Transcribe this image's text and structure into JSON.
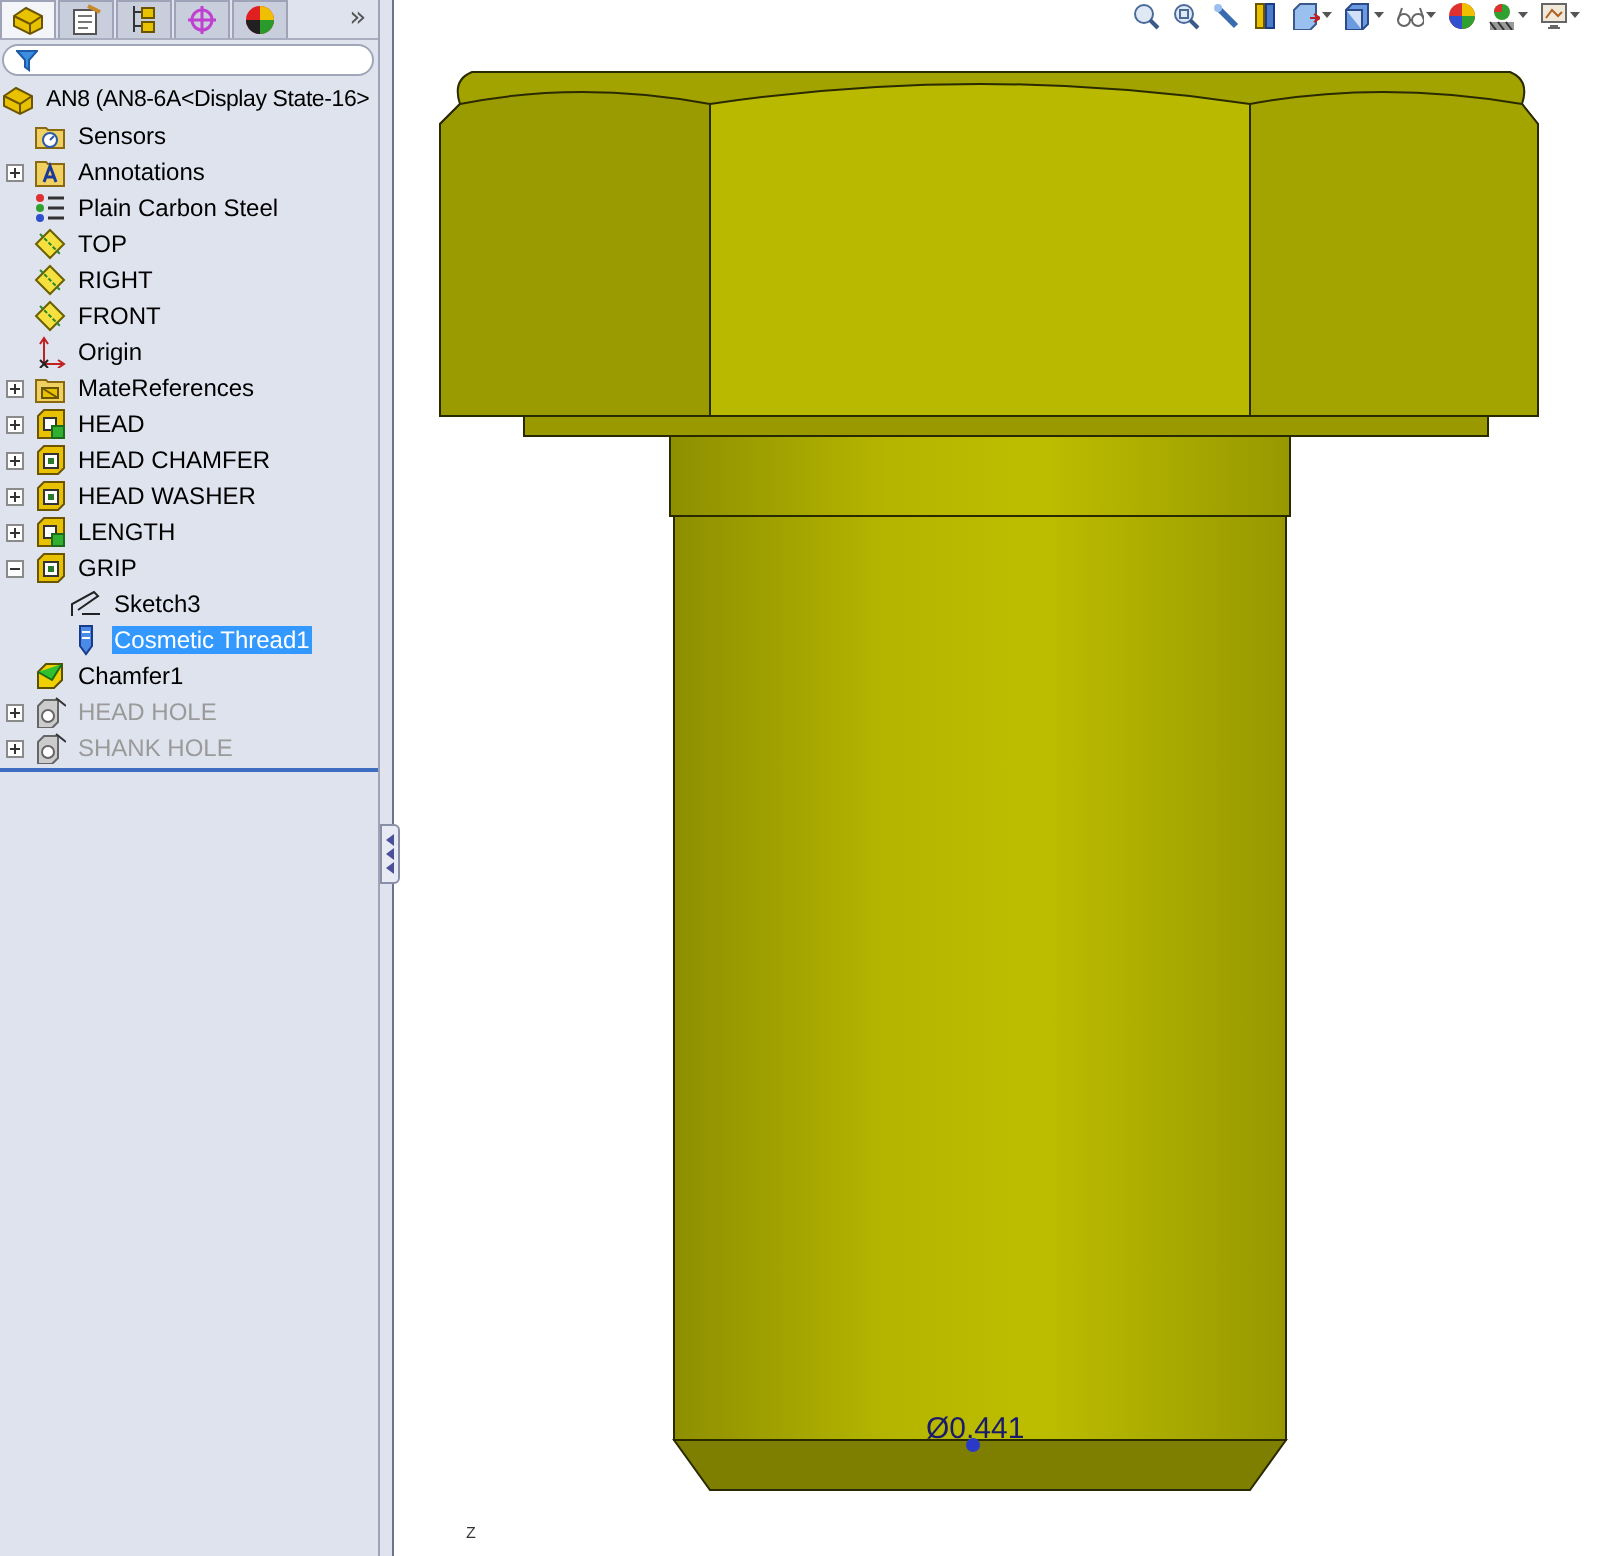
{
  "feature_tree": {
    "tabs": [
      {
        "kind": "feature",
        "selected": true
      },
      {
        "kind": "property",
        "selected": false
      },
      {
        "kind": "config",
        "selected": false
      },
      {
        "kind": "dimxpert",
        "selected": false
      },
      {
        "kind": "display",
        "selected": false
      }
    ],
    "overflow": "»",
    "root": {
      "label": "AN8  (AN8-6A<Display State-16>",
      "kind": "part"
    },
    "items": [
      {
        "label": "Sensors",
        "kind": "sensor",
        "selected": false,
        "disabled": false
      },
      {
        "label": "Annotations",
        "kind": "annotation",
        "expanded": false,
        "selected": false,
        "disabled": false
      },
      {
        "label": "Plain Carbon Steel",
        "kind": "material",
        "selected": false,
        "disabled": false
      },
      {
        "label": "TOP",
        "kind": "plane",
        "selected": false,
        "disabled": false
      },
      {
        "label": "RIGHT",
        "kind": "plane",
        "selected": false,
        "disabled": false
      },
      {
        "label": "FRONT",
        "kind": "plane",
        "selected": false,
        "disabled": false
      },
      {
        "label": "Origin",
        "kind": "origin",
        "selected": false,
        "disabled": false
      },
      {
        "label": "MateReferences",
        "kind": "mate",
        "expanded": false,
        "selected": false,
        "disabled": false
      },
      {
        "label": "HEAD",
        "kind": "boss",
        "expanded": false,
        "selected": false,
        "disabled": false
      },
      {
        "label": "HEAD CHAMFER",
        "kind": "feature",
        "expanded": false,
        "selected": false,
        "disabled": false
      },
      {
        "label": "HEAD WASHER",
        "kind": "feature",
        "expanded": false,
        "selected": false,
        "disabled": false
      },
      {
        "label": "LENGTH",
        "kind": "boss",
        "expanded": false,
        "selected": false,
        "disabled": false
      },
      {
        "label": "GRIP",
        "kind": "feature",
        "expanded": true,
        "selected": false,
        "disabled": false,
        "children": [
          {
            "label": "Sketch3",
            "kind": "sketch",
            "selected": false,
            "disabled": false
          },
          {
            "label": "Cosmetic Thread1",
            "kind": "thread",
            "selected": true,
            "disabled": false
          }
        ]
      },
      {
        "label": "Chamfer1",
        "kind": "chamfer",
        "selected": false,
        "disabled": false
      },
      {
        "label": "HEAD HOLE",
        "kind": "hole",
        "expanded": false,
        "selected": false,
        "disabled": true
      },
      {
        "label": "SHANK HOLE",
        "kind": "hole",
        "expanded": false,
        "selected": false,
        "disabled": true
      }
    ]
  },
  "viewport": {
    "dimension": "Ø0.441",
    "axis_label": "Z"
  }
}
